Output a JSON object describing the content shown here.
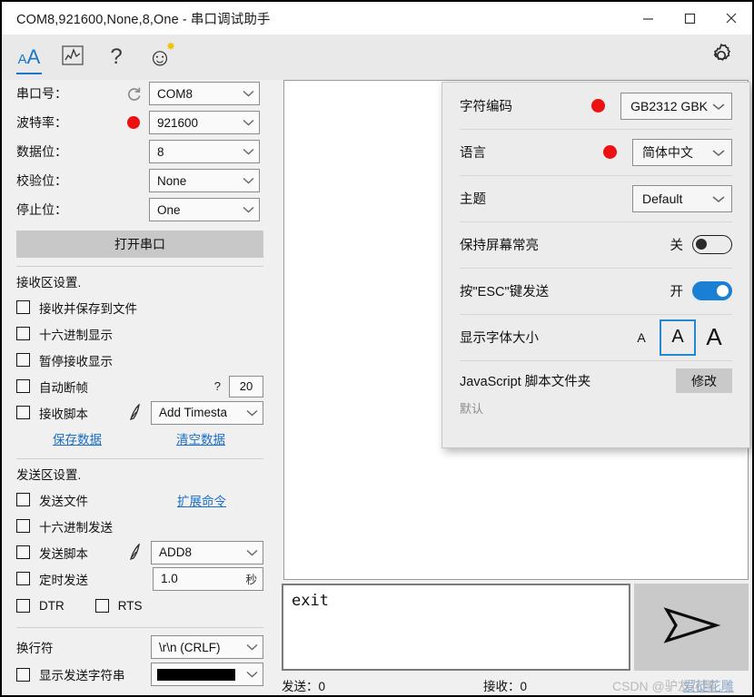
{
  "window": {
    "title": "COM8,921600,None,8,One - 串口调试助手",
    "minimize_label": "minimize",
    "maximize_label": "maximize",
    "close_label": "close"
  },
  "toolbar": {
    "font_icon_small": "A",
    "font_icon_big": "A",
    "chart_icon": "chart-icon",
    "help_icon": "?",
    "emoji_icon": "☺",
    "emoji_badge": "✸",
    "gear_icon": "gear-icon"
  },
  "serial": {
    "rows": [
      {
        "label": "串口号：",
        "value": "COM8",
        "indicator": "refresh"
      },
      {
        "label": "波特率：",
        "value": "921600",
        "indicator": "dot"
      },
      {
        "label": "数据位：",
        "value": "8",
        "indicator": "none"
      },
      {
        "label": "校验位：",
        "value": "None",
        "indicator": "none"
      },
      {
        "label": "停止位：",
        "value": "One",
        "indicator": "none"
      }
    ],
    "open_button": "打开串口"
  },
  "receive": {
    "section_title": "接收区设置.",
    "checkboxes": [
      "接收并保存到文件",
      "十六进制显示",
      "暂停接收显示",
      "自动断帧",
      "接收脚本"
    ],
    "auto_frame_help": "?",
    "auto_frame_value": "20",
    "script_value": "Add Timesta",
    "save_link": "保存数据",
    "clear_link": "清空数据"
  },
  "send": {
    "section_title": "发送区设置.",
    "checkboxes": [
      "发送文件",
      "十六进制发送",
      "发送脚本",
      "定时发送"
    ],
    "extend_link": "扩展命令",
    "script_value": "ADD8",
    "interval_value": "1.0",
    "interval_unit": "秒",
    "dtr_label": "DTR",
    "rts_label": "RTS"
  },
  "lineend": {
    "label": "换行符",
    "value": "\\r\\n (CRLF)",
    "show_string_label": "显示发送字符串",
    "color_value": "#000000"
  },
  "main": {
    "send_text": "exit",
    "send_icon": "send-arrow-icon",
    "status_send": "发送：0",
    "status_recv": "接收：0",
    "watermark": "CSDN @驴友花雕",
    "watermark_overlay": "爱徒花雕"
  },
  "settings": {
    "rows": [
      {
        "label": "字符编码",
        "dot": true,
        "value": "GB2312 GBK"
      },
      {
        "label": "语言",
        "dot": true,
        "value": "简体中文"
      },
      {
        "label": "主题",
        "dot": false,
        "value": "Default"
      }
    ],
    "keep_screen": {
      "label": "保持屏幕常亮",
      "state_text": "关",
      "on": false
    },
    "esc_send": {
      "label": "按\"ESC\"键发送",
      "state_text": "开",
      "on": true
    },
    "font_size": {
      "label": "显示字体大小",
      "options": [
        "A",
        "A",
        "A"
      ],
      "selected_index": 1
    },
    "js_folder": {
      "label": "JavaScript 脚本文件夹",
      "button": "修改",
      "sub": "默认"
    }
  },
  "colors": {
    "accent": "#1b7fd4",
    "red_dot": "#ee1111",
    "link": "#1a6fc4",
    "panel_bg": "#ececec",
    "sidebar_bg": "#f0f0f0"
  }
}
